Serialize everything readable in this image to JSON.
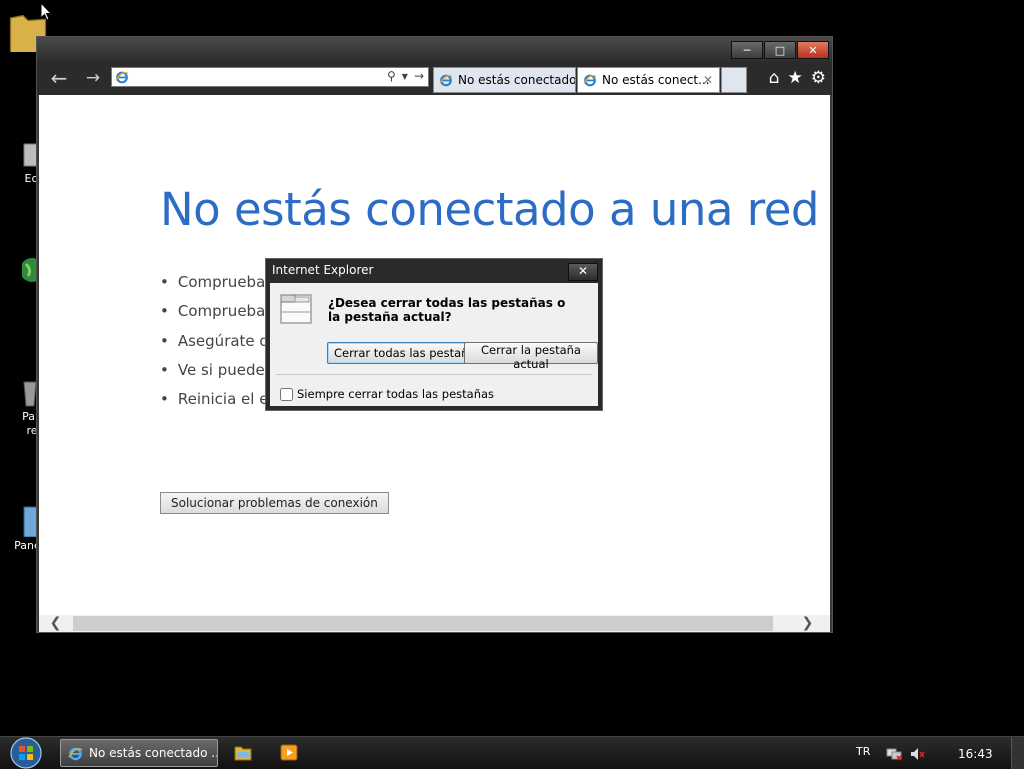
{
  "desktop": {
    "icons": [
      {
        "label": "Ec",
        "icon": "folder-icon"
      },
      {
        "label": "",
        "icon": "globe-icon"
      },
      {
        "label": "Pap\nre",
        "icon": "recycle-bin-icon"
      },
      {
        "label": "Panel",
        "icon": "control-panel-icon"
      }
    ]
  },
  "browser": {
    "window_buttons": [
      "minimize",
      "maximize",
      "close"
    ],
    "address": {
      "value": "",
      "placeholder": ""
    },
    "tabs": [
      {
        "title": "No estás conectado...",
        "active": false
      },
      {
        "title": "No estás conect...",
        "active": true
      }
    ],
    "toolbar_icons": [
      "home-icon",
      "favorites-icon",
      "settings-icon"
    ],
    "page": {
      "headline": "No estás conectado a una red",
      "bullets": [
        "Comprueba o",
        "Comprueba o",
        "Asegúrate de",
        "Ve si puedes c",
        "Reinicia el enr"
      ],
      "button": "Solucionar problemas de conexión"
    }
  },
  "dialog": {
    "title": "Internet Explorer",
    "question": "¿Desea cerrar todas las pestañas o la pestaña actual?",
    "primary_button": "Cerrar todas las pestañas",
    "secondary_button": "Cerrar la pestaña actual",
    "checkbox_label": "Siempre cerrar todas las pestañas",
    "checkbox_checked": false
  },
  "taskbar": {
    "task_item": "No estás conectado ...",
    "language": "TR",
    "clock": "16:43"
  },
  "colors": {
    "headline": "#2c6cc4",
    "background": "#000000"
  }
}
